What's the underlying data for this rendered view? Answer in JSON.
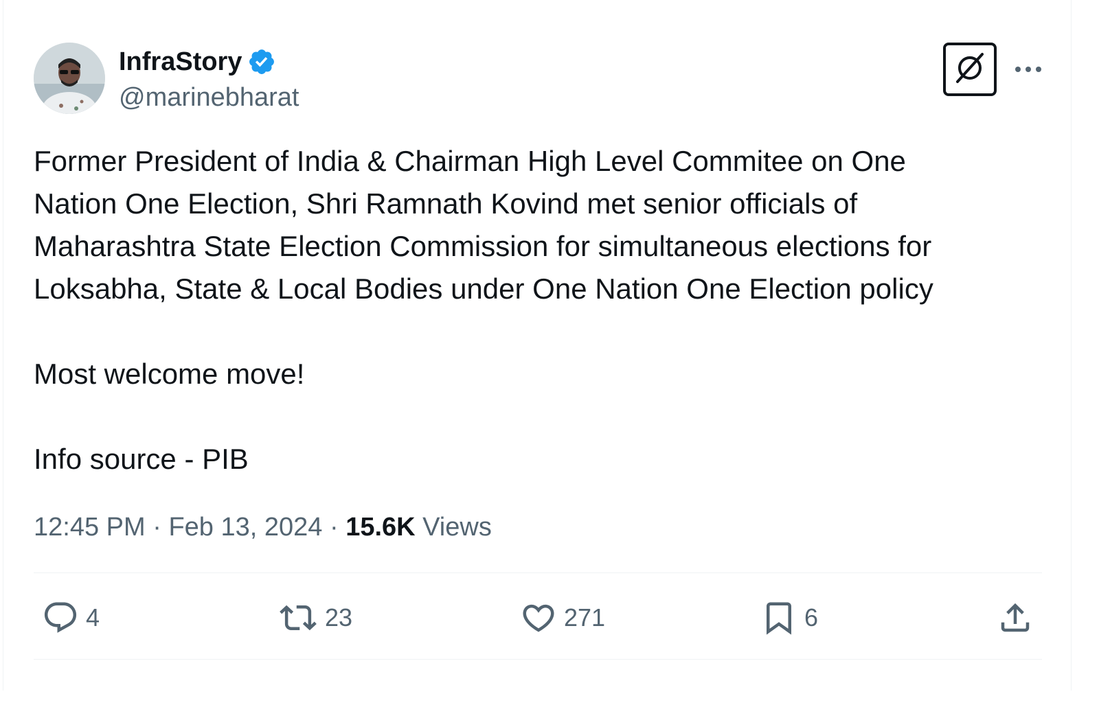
{
  "author": {
    "display_name": "InfraStory",
    "handle": "@marinebharat",
    "verified": true
  },
  "tweet": {
    "text": "Former President of India & Chairman High Level Commitee on One\nNation One Election, Shri Ramnath Kovind met senior officials of\nMaharashtra State Election Commission for simultaneous elections for\nLoksabha, State & Local Bodies under One Nation One Election policy\n\nMost welcome move!\n\nInfo source - PIB",
    "time": "12:45 PM",
    "separator": " · ",
    "date": "Feb 13, 2024",
    "views_count": "15.6K",
    "views_label": " Views"
  },
  "actions": {
    "replies": "4",
    "reposts": "23",
    "likes": "271",
    "bookmarks": "6"
  },
  "icons": {
    "verified": "verified-badge-icon",
    "grok": "grok-icon",
    "more": "more-dots-icon",
    "reply": "reply-bubble-icon",
    "repost": "repost-arrows-icon",
    "like": "heart-icon",
    "bookmark": "bookmark-icon",
    "share": "share-upload-icon"
  },
  "colors": {
    "verified_blue": "#1d9bf0",
    "secondary_text": "#536471",
    "primary_text": "#0f1419",
    "divider": "#eff3f4"
  }
}
